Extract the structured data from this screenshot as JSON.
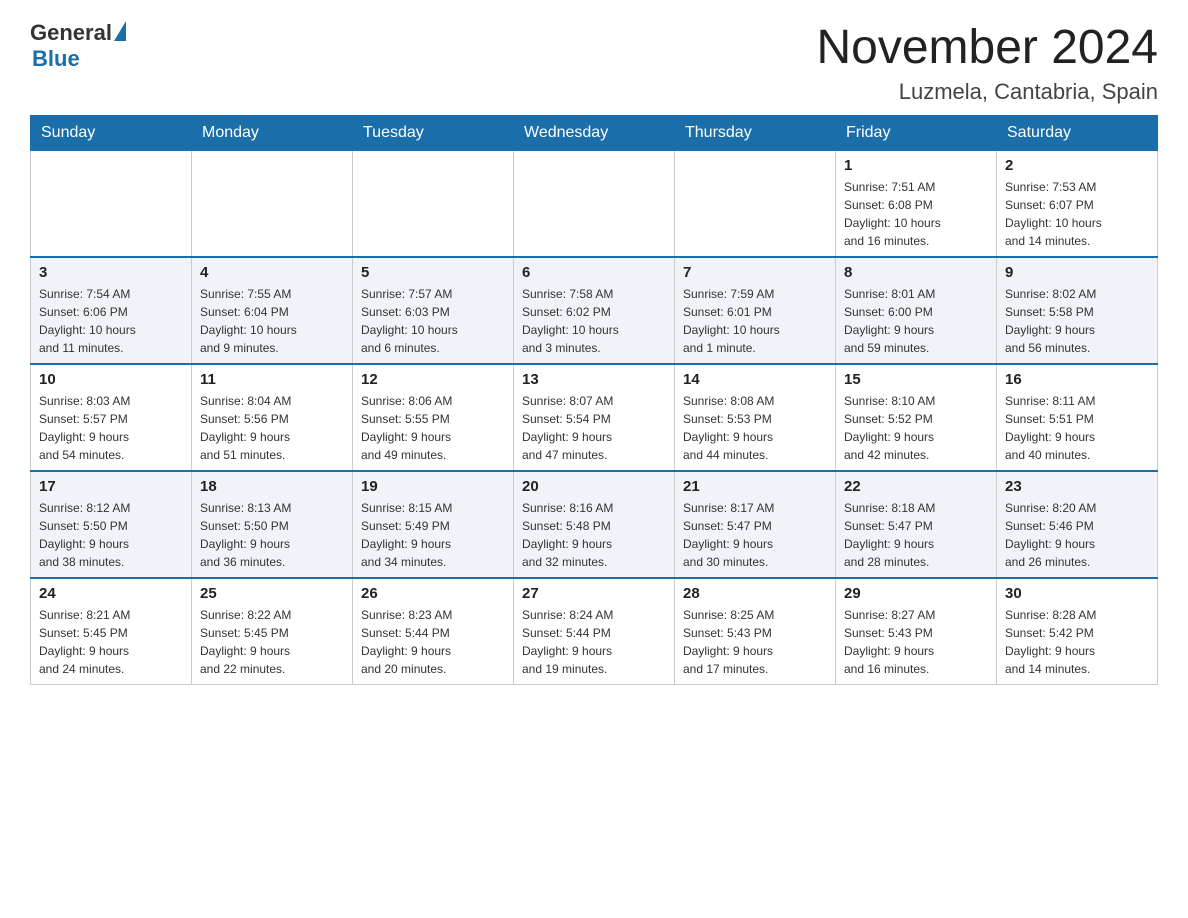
{
  "header": {
    "logo_general": "General",
    "logo_blue": "Blue",
    "month_title": "November 2024",
    "location": "Luzmela, Cantabria, Spain"
  },
  "weekdays": [
    "Sunday",
    "Monday",
    "Tuesday",
    "Wednesday",
    "Thursday",
    "Friday",
    "Saturday"
  ],
  "weeks": [
    [
      {
        "day": "",
        "info": ""
      },
      {
        "day": "",
        "info": ""
      },
      {
        "day": "",
        "info": ""
      },
      {
        "day": "",
        "info": ""
      },
      {
        "day": "",
        "info": ""
      },
      {
        "day": "1",
        "info": "Sunrise: 7:51 AM\nSunset: 6:08 PM\nDaylight: 10 hours\nand 16 minutes."
      },
      {
        "day": "2",
        "info": "Sunrise: 7:53 AM\nSunset: 6:07 PM\nDaylight: 10 hours\nand 14 minutes."
      }
    ],
    [
      {
        "day": "3",
        "info": "Sunrise: 7:54 AM\nSunset: 6:06 PM\nDaylight: 10 hours\nand 11 minutes."
      },
      {
        "day": "4",
        "info": "Sunrise: 7:55 AM\nSunset: 6:04 PM\nDaylight: 10 hours\nand 9 minutes."
      },
      {
        "day": "5",
        "info": "Sunrise: 7:57 AM\nSunset: 6:03 PM\nDaylight: 10 hours\nand 6 minutes."
      },
      {
        "day": "6",
        "info": "Sunrise: 7:58 AM\nSunset: 6:02 PM\nDaylight: 10 hours\nand 3 minutes."
      },
      {
        "day": "7",
        "info": "Sunrise: 7:59 AM\nSunset: 6:01 PM\nDaylight: 10 hours\nand 1 minute."
      },
      {
        "day": "8",
        "info": "Sunrise: 8:01 AM\nSunset: 6:00 PM\nDaylight: 9 hours\nand 59 minutes."
      },
      {
        "day": "9",
        "info": "Sunrise: 8:02 AM\nSunset: 5:58 PM\nDaylight: 9 hours\nand 56 minutes."
      }
    ],
    [
      {
        "day": "10",
        "info": "Sunrise: 8:03 AM\nSunset: 5:57 PM\nDaylight: 9 hours\nand 54 minutes."
      },
      {
        "day": "11",
        "info": "Sunrise: 8:04 AM\nSunset: 5:56 PM\nDaylight: 9 hours\nand 51 minutes."
      },
      {
        "day": "12",
        "info": "Sunrise: 8:06 AM\nSunset: 5:55 PM\nDaylight: 9 hours\nand 49 minutes."
      },
      {
        "day": "13",
        "info": "Sunrise: 8:07 AM\nSunset: 5:54 PM\nDaylight: 9 hours\nand 47 minutes."
      },
      {
        "day": "14",
        "info": "Sunrise: 8:08 AM\nSunset: 5:53 PM\nDaylight: 9 hours\nand 44 minutes."
      },
      {
        "day": "15",
        "info": "Sunrise: 8:10 AM\nSunset: 5:52 PM\nDaylight: 9 hours\nand 42 minutes."
      },
      {
        "day": "16",
        "info": "Sunrise: 8:11 AM\nSunset: 5:51 PM\nDaylight: 9 hours\nand 40 minutes."
      }
    ],
    [
      {
        "day": "17",
        "info": "Sunrise: 8:12 AM\nSunset: 5:50 PM\nDaylight: 9 hours\nand 38 minutes."
      },
      {
        "day": "18",
        "info": "Sunrise: 8:13 AM\nSunset: 5:50 PM\nDaylight: 9 hours\nand 36 minutes."
      },
      {
        "day": "19",
        "info": "Sunrise: 8:15 AM\nSunset: 5:49 PM\nDaylight: 9 hours\nand 34 minutes."
      },
      {
        "day": "20",
        "info": "Sunrise: 8:16 AM\nSunset: 5:48 PM\nDaylight: 9 hours\nand 32 minutes."
      },
      {
        "day": "21",
        "info": "Sunrise: 8:17 AM\nSunset: 5:47 PM\nDaylight: 9 hours\nand 30 minutes."
      },
      {
        "day": "22",
        "info": "Sunrise: 8:18 AM\nSunset: 5:47 PM\nDaylight: 9 hours\nand 28 minutes."
      },
      {
        "day": "23",
        "info": "Sunrise: 8:20 AM\nSunset: 5:46 PM\nDaylight: 9 hours\nand 26 minutes."
      }
    ],
    [
      {
        "day": "24",
        "info": "Sunrise: 8:21 AM\nSunset: 5:45 PM\nDaylight: 9 hours\nand 24 minutes."
      },
      {
        "day": "25",
        "info": "Sunrise: 8:22 AM\nSunset: 5:45 PM\nDaylight: 9 hours\nand 22 minutes."
      },
      {
        "day": "26",
        "info": "Sunrise: 8:23 AM\nSunset: 5:44 PM\nDaylight: 9 hours\nand 20 minutes."
      },
      {
        "day": "27",
        "info": "Sunrise: 8:24 AM\nSunset: 5:44 PM\nDaylight: 9 hours\nand 19 minutes."
      },
      {
        "day": "28",
        "info": "Sunrise: 8:25 AM\nSunset: 5:43 PM\nDaylight: 9 hours\nand 17 minutes."
      },
      {
        "day": "29",
        "info": "Sunrise: 8:27 AM\nSunset: 5:43 PM\nDaylight: 9 hours\nand 16 minutes."
      },
      {
        "day": "30",
        "info": "Sunrise: 8:28 AM\nSunset: 5:42 PM\nDaylight: 9 hours\nand 14 minutes."
      }
    ]
  ]
}
